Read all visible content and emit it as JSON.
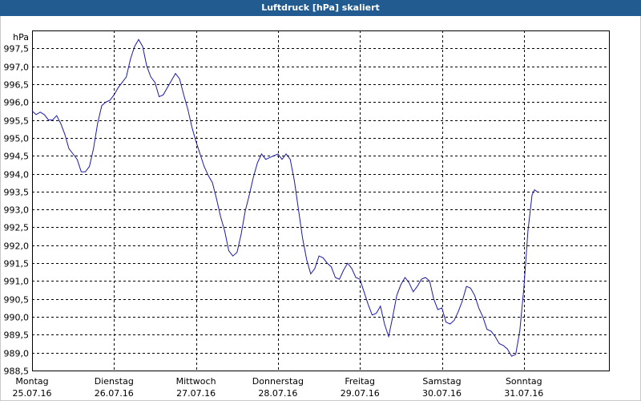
{
  "window": {
    "title": "Luftdruck [hPa] skaliert"
  },
  "colors": {
    "titlebar": "#215b8f",
    "line": "#1a1aa8",
    "grid": "#000000"
  },
  "chart_data": {
    "type": "line",
    "title": "Luftdruck [hPa] skaliert",
    "ylabel": "hPa",
    "xlabel": "",
    "grid": true,
    "ylim": [
      988.5,
      998.0
    ],
    "y_ticks": [
      "988,5",
      "989,0",
      "989,5",
      "990,0",
      "990,5",
      "991,0",
      "991,5",
      "992,0",
      "992,5",
      "993,0",
      "993,5",
      "994,0",
      "994,5",
      "995,0",
      "995,5",
      "996,0",
      "996,5",
      "997,0",
      "997,5"
    ],
    "x_ticks": [
      {
        "day": "Montag",
        "date": "25.07.16"
      },
      {
        "day": "Dienstag",
        "date": "26.07.16"
      },
      {
        "day": "Mittwoch",
        "date": "27.07.16"
      },
      {
        "day": "Donnerstag",
        "date": "28.07.16"
      },
      {
        "day": "Freitag",
        "date": "29.07.16"
      },
      {
        "day": "Samstag",
        "date": "30.07.16"
      },
      {
        "day": "Sonntag",
        "date": "31.07.16"
      }
    ],
    "xlim_days": [
      0,
      7
    ],
    "series": [
      {
        "points": [
          [
            0.0,
            995.75
          ],
          [
            0.05,
            995.65
          ],
          [
            0.1,
            995.72
          ],
          [
            0.15,
            995.65
          ],
          [
            0.2,
            995.5
          ],
          [
            0.25,
            995.5
          ],
          [
            0.3,
            995.62
          ],
          [
            0.35,
            995.4
          ],
          [
            0.4,
            995.1
          ],
          [
            0.45,
            994.7
          ],
          [
            0.5,
            994.55
          ],
          [
            0.55,
            994.4
          ],
          [
            0.6,
            994.05
          ],
          [
            0.65,
            994.05
          ],
          [
            0.7,
            994.2
          ],
          [
            0.75,
            994.7
          ],
          [
            0.8,
            995.4
          ],
          [
            0.85,
            995.9
          ],
          [
            0.9,
            996.0
          ],
          [
            0.95,
            996.05
          ],
          [
            1.0,
            996.2
          ],
          [
            1.05,
            996.4
          ],
          [
            1.1,
            996.55
          ],
          [
            1.15,
            996.7
          ],
          [
            1.2,
            997.2
          ],
          [
            1.25,
            997.55
          ],
          [
            1.3,
            997.75
          ],
          [
            1.35,
            997.55
          ],
          [
            1.4,
            997.0
          ],
          [
            1.45,
            996.7
          ],
          [
            1.5,
            996.55
          ],
          [
            1.55,
            996.15
          ],
          [
            1.6,
            996.2
          ],
          [
            1.65,
            996.4
          ],
          [
            1.7,
            996.6
          ],
          [
            1.75,
            996.8
          ],
          [
            1.8,
            996.65
          ],
          [
            1.85,
            996.2
          ],
          [
            1.9,
            995.8
          ],
          [
            1.95,
            995.3
          ],
          [
            2.0,
            994.9
          ],
          [
            2.05,
            994.55
          ],
          [
            2.1,
            994.2
          ],
          [
            2.15,
            993.95
          ],
          [
            2.2,
            993.75
          ],
          [
            2.25,
            993.3
          ],
          [
            2.3,
            992.8
          ],
          [
            2.35,
            992.4
          ],
          [
            2.4,
            991.85
          ],
          [
            2.45,
            991.7
          ],
          [
            2.5,
            991.8
          ],
          [
            2.55,
            992.3
          ],
          [
            2.6,
            992.95
          ],
          [
            2.65,
            993.4
          ],
          [
            2.7,
            993.9
          ],
          [
            2.75,
            994.3
          ],
          [
            2.8,
            994.55
          ],
          [
            2.85,
            994.4
          ],
          [
            2.9,
            994.45
          ],
          [
            2.95,
            994.5
          ],
          [
            3.0,
            994.55
          ],
          [
            3.05,
            994.4
          ],
          [
            3.1,
            994.55
          ],
          [
            3.15,
            994.4
          ],
          [
            3.2,
            993.8
          ],
          [
            3.25,
            993.0
          ],
          [
            3.3,
            992.2
          ],
          [
            3.35,
            991.6
          ],
          [
            3.4,
            991.2
          ],
          [
            3.45,
            991.35
          ],
          [
            3.5,
            991.7
          ],
          [
            3.55,
            991.65
          ],
          [
            3.6,
            991.5
          ],
          [
            3.65,
            991.4
          ],
          [
            3.7,
            991.1
          ],
          [
            3.75,
            991.05
          ],
          [
            3.8,
            991.3
          ],
          [
            3.85,
            991.5
          ],
          [
            3.9,
            991.35
          ],
          [
            3.95,
            991.1
          ],
          [
            4.0,
            991.05
          ],
          [
            4.05,
            990.7
          ],
          [
            4.1,
            990.35
          ],
          [
            4.15,
            990.05
          ],
          [
            4.2,
            990.1
          ],
          [
            4.25,
            990.3
          ],
          [
            4.3,
            989.8
          ],
          [
            4.35,
            989.45
          ],
          [
            4.4,
            990.0
          ],
          [
            4.45,
            990.6
          ],
          [
            4.5,
            990.9
          ],
          [
            4.55,
            991.1
          ],
          [
            4.6,
            990.95
          ],
          [
            4.65,
            990.7
          ],
          [
            4.7,
            990.85
          ],
          [
            4.75,
            991.05
          ],
          [
            4.8,
            991.1
          ],
          [
            4.85,
            991.0
          ],
          [
            4.9,
            990.5
          ],
          [
            4.95,
            990.2
          ],
          [
            5.0,
            990.25
          ],
          [
            5.05,
            989.85
          ],
          [
            5.1,
            989.8
          ],
          [
            5.15,
            989.9
          ],
          [
            5.2,
            990.15
          ],
          [
            5.25,
            990.45
          ],
          [
            5.3,
            990.85
          ],
          [
            5.35,
            990.8
          ],
          [
            5.4,
            990.6
          ],
          [
            5.45,
            990.25
          ],
          [
            5.5,
            990.0
          ],
          [
            5.55,
            989.65
          ],
          [
            5.6,
            989.6
          ],
          [
            5.65,
            989.45
          ],
          [
            5.7,
            989.25
          ],
          [
            5.75,
            989.2
          ],
          [
            5.8,
            989.1
          ],
          [
            5.85,
            988.9
          ],
          [
            5.9,
            988.95
          ],
          [
            5.95,
            989.6
          ],
          [
            6.0,
            990.8
          ],
          [
            6.05,
            992.4
          ],
          [
            6.1,
            993.4
          ],
          [
            6.13,
            993.55
          ],
          [
            6.16,
            993.5
          ]
        ]
      }
    ]
  }
}
